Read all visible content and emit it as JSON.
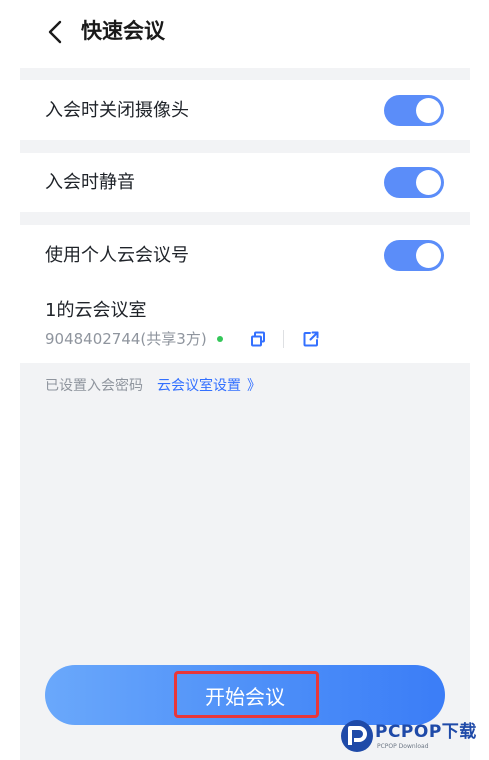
{
  "header": {
    "title": "快速会议",
    "back_icon": "chevron-left-icon"
  },
  "settings": [
    {
      "label": "入会时关闭摄像头",
      "enabled": true
    },
    {
      "label": "入会时静音",
      "enabled": true
    },
    {
      "label": "使用个人云会议号",
      "enabled": true
    }
  ],
  "room": {
    "name": "1的云会议室",
    "id_text": "9048402744(共享3方)",
    "status_color": "#34c759",
    "copy_icon": "copy-icon",
    "share_icon": "share-icon"
  },
  "password_hint": "已设置入会密码",
  "room_settings_link": "云会议室设置",
  "room_settings_chevron": "》",
  "start_button": {
    "label": "开始会议"
  },
  "watermark": {
    "text": "PCPOP下载",
    "subtext": "PCPOP Download"
  },
  "colors": {
    "accent": "#3370ff",
    "toggle_on": "#5b8df9",
    "highlight": "#e8373a",
    "section_gray": "#f2f3f5"
  }
}
